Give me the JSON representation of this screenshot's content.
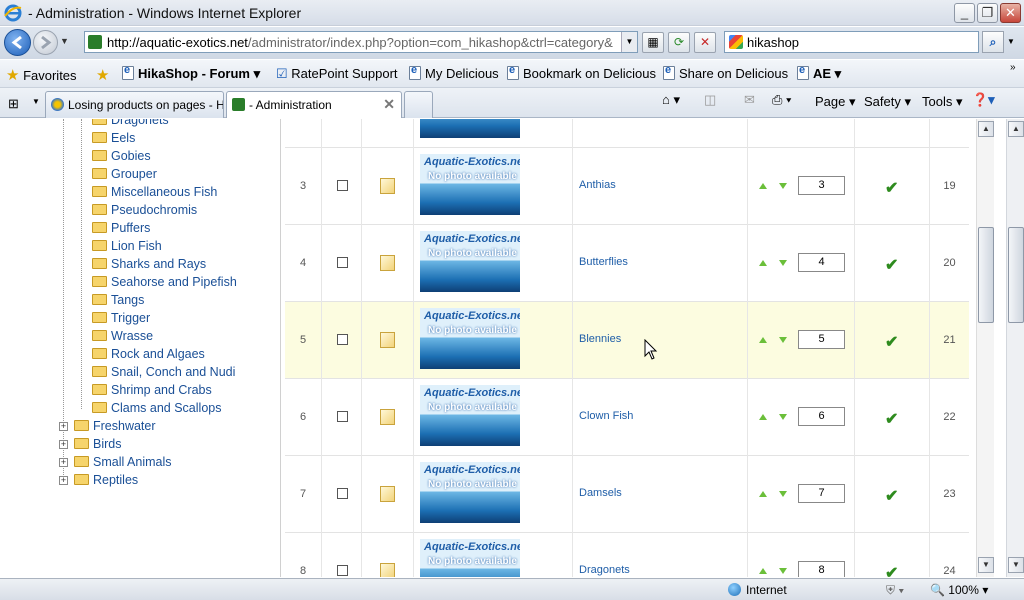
{
  "window": {
    "title": "- Administration - Windows Internet Explorer"
  },
  "address": {
    "url_domain": "http://aquatic-exotics.net",
    "url_path": "/administrator/index.php?option=com_hikashop&ctrl=category&",
    "search_value": "hikashop"
  },
  "favorites": {
    "favorites_label": "Favorites",
    "items": [
      "HikaShop - Forum",
      "RatePoint Support",
      "My Delicious",
      "Bookmark on Delicious",
      "Share on Delicious",
      "AE"
    ]
  },
  "tabs": [
    {
      "label": "Losing products on pages - H..."
    },
    {
      "label": "- Administration"
    }
  ],
  "commands": {
    "page": "Page",
    "safety": "Safety",
    "tools": "Tools"
  },
  "tree": {
    "items": [
      "Dragonets",
      "Eels",
      "Gobies",
      "Grouper",
      "Miscellaneous Fish",
      "Pseudochromis",
      "Puffers",
      "Lion Fish",
      "Sharks and Rays",
      "Seahorse and Pipefish",
      "Tangs",
      "Trigger",
      "Wrasse",
      "Rock and Algaes",
      "Snail, Conch and Nudi",
      "Shrimp and Crabs",
      "Clams and Scallops"
    ],
    "top_items": [
      "Freshwater",
      "Birds",
      "Small Animals",
      "Reptiles"
    ]
  },
  "thumb": {
    "brand": "Aquatic-Exotics.net",
    "caption": "No photo available"
  },
  "rows": [
    {
      "num": "3",
      "name": "Anthias",
      "order": "3",
      "id": "19"
    },
    {
      "num": "4",
      "name": "Butterflies",
      "order": "4",
      "id": "20"
    },
    {
      "num": "5",
      "name": "Blennies",
      "order": "5",
      "id": "21"
    },
    {
      "num": "6",
      "name": "Clown Fish",
      "order": "6",
      "id": "22"
    },
    {
      "num": "7",
      "name": "Damsels",
      "order": "7",
      "id": "23"
    },
    {
      "num": "8",
      "name": "Dragonets",
      "order": "8",
      "id": "24"
    }
  ],
  "status": {
    "zone": "Internet",
    "zoom": "100%"
  },
  "colors": {
    "link": "#1f5ea8",
    "highlight_row": "#fcfce0",
    "published_check": "#2e8b1e",
    "order_arrow": "#6bbf3a"
  }
}
